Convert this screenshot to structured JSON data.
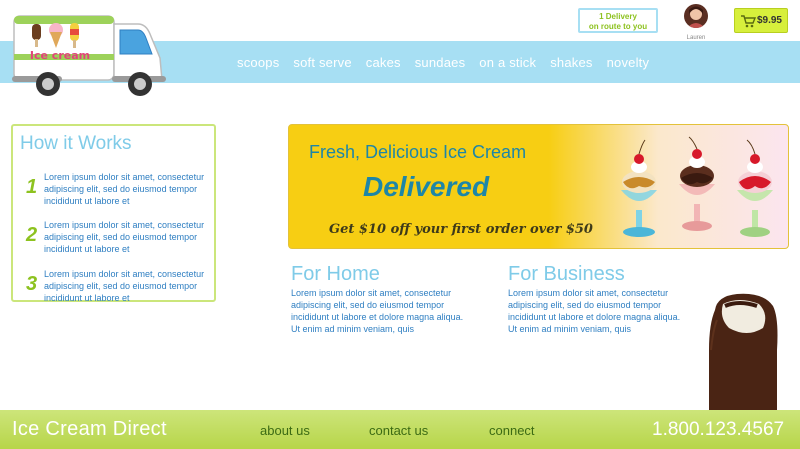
{
  "nav": {
    "items": [
      "scoops",
      "soft serve",
      "cakes",
      "sundaes",
      "on a stick",
      "shakes",
      "novelty"
    ]
  },
  "logo": {
    "text": "Ice cream"
  },
  "delivery": {
    "line1": "1 Delivery",
    "line2": "on route to you"
  },
  "user": {
    "name": "Lauren"
  },
  "cart": {
    "total": "$9.95"
  },
  "how_it_works": {
    "title": "How it Works",
    "steps": [
      {
        "num": "1",
        "text": "Lorem ipsum dolor sit amet, consectetur adipiscing elit, sed do eiusmod tempor incididunt ut labore et"
      },
      {
        "num": "2",
        "text": "Lorem ipsum dolor sit amet, consectetur adipiscing elit, sed do eiusmod tempor incididunt ut labore et"
      },
      {
        "num": "3",
        "text": "Lorem ipsum dolor sit amet, consectetur adipiscing elit, sed do eiusmod tempor incididunt ut labore et"
      }
    ]
  },
  "promo": {
    "headline": "Fresh, Delicious Ice Cream",
    "big": "Delivered",
    "offer": "Get $10 off your first order over $50"
  },
  "home": {
    "title": "For Home",
    "text": "Lorem ipsum dolor sit amet, consectetur adipiscing elit, sed do eiusmod tempor incididunt ut labore et dolore magna aliqua. Ut enim ad minim veniam, quis"
  },
  "business": {
    "title": "For Business",
    "text": "Lorem ipsum dolor sit amet, consectetur adipiscing elit, sed do eiusmod tempor incididunt ut labore et dolore magna aliqua. Ut enim ad minim veniam, quis"
  },
  "footer": {
    "brand": "Ice Cream Direct",
    "links": [
      "about us",
      "contact us",
      "connect"
    ],
    "phone": "1.800.123.4567"
  },
  "colors": {
    "nav_band": "#a7dff3",
    "accent_green": "#8dc21f",
    "title_blue": "#7fcbe8",
    "text_blue": "#2f7fc2",
    "promo_yellow": "#f7ce13",
    "cart_lime": "#d7ef3c"
  }
}
